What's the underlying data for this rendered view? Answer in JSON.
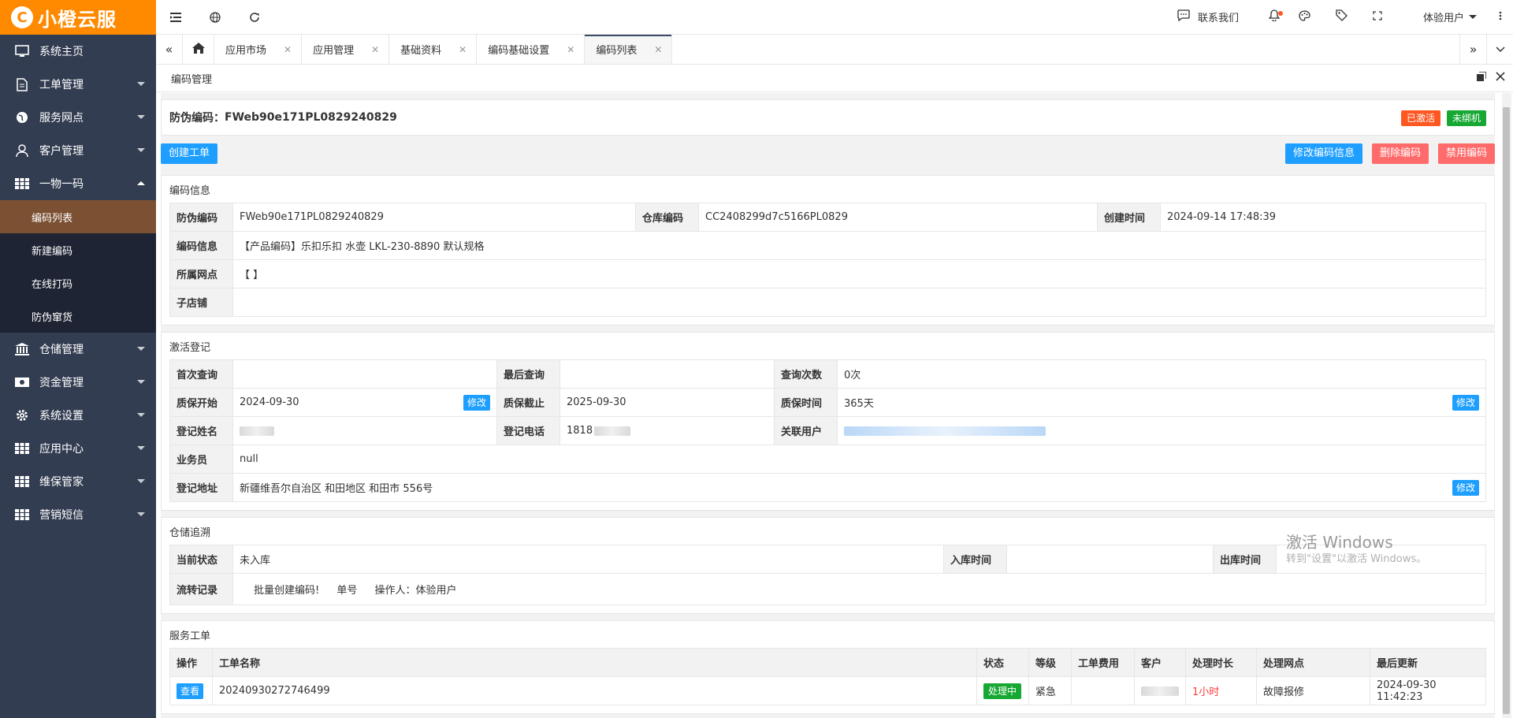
{
  "sidebar": {
    "logo_mark": "C",
    "logo_text": "小橙云服",
    "items": [
      {
        "label": "系统主页"
      },
      {
        "label": "工单管理"
      },
      {
        "label": "服务网点"
      },
      {
        "label": "客户管理"
      },
      {
        "label": "一物一码"
      },
      {
        "label": "仓储管理"
      },
      {
        "label": "资金管理"
      },
      {
        "label": "系统设置"
      },
      {
        "label": "应用中心"
      },
      {
        "label": "维保管家"
      },
      {
        "label": "营销短信"
      }
    ],
    "sub_items": [
      {
        "label": "编码列表"
      },
      {
        "label": "新建编码"
      },
      {
        "label": "在线打码"
      },
      {
        "label": "防伪窜货"
      }
    ]
  },
  "topbar": {
    "contact": "联系我们",
    "user": "体验用户"
  },
  "tabs": [
    {
      "label": "应用市场"
    },
    {
      "label": "应用管理"
    },
    {
      "label": "基础资料"
    },
    {
      "label": "编码基础设置"
    },
    {
      "label": "编码列表"
    }
  ],
  "panel": {
    "title": "编码管理",
    "code_label": "防伪编码：",
    "code_value": "FWeb90e171PL0829240829",
    "badge_activated": "已激活",
    "badge_not_bound": "未绑机",
    "btn_create_order": "创建工单",
    "btn_edit_info": "修改编码信息",
    "btn_delete": "删除编码",
    "btn_disable": "禁用编码"
  },
  "code_info": {
    "title": "编码信息",
    "fw_label": "防伪编码",
    "fw_value": "FWeb90e171PL0829240829",
    "warehouse_label": "仓库编码",
    "warehouse_value": "CC2408299d7c5166PL0829",
    "created_label": "创建时间",
    "created_value": "2024-09-14 17:48:39",
    "info_label": "编码信息",
    "info_value": "【产品编码】乐扣乐扣 水壶 LKL-230-8890 默认规格",
    "outlet_label": "所属网点",
    "outlet_value": "【 】",
    "substore_label": "子店铺",
    "substore_value": ""
  },
  "activation": {
    "title": "激活登记",
    "first_query_label": "首次查询",
    "first_query_value": "",
    "last_query_label": "最后查询",
    "last_query_value": "",
    "query_count_label": "查询次数",
    "query_count_value": "0次",
    "warranty_start_label": "质保开始",
    "warranty_start_value": "2024-09-30",
    "warranty_end_label": "质保截止",
    "warranty_end_value": "2025-09-30",
    "warranty_time_label": "质保时间",
    "warranty_time_value": "365天",
    "name_label": "登记姓名",
    "phone_label": "登记电话",
    "phone_value": "1818",
    "linked_user_label": "关联用户",
    "salesman_label": "业务员",
    "salesman_value": "null",
    "address_label": "登记地址",
    "address_value": "新疆维吾尔自治区 和田地区 和田市 556号",
    "edit": "修改"
  },
  "warehouse": {
    "title": "仓储追溯",
    "state_label": "当前状态",
    "state_value": "未入库",
    "in_label": "入库时间",
    "in_value": "",
    "out_label": "出库时间",
    "out_value": "",
    "flow_label": "流转记录",
    "flow_text": "批量创建编码!",
    "flow_no": "单号",
    "flow_operator": "操作人：体验用户"
  },
  "service": {
    "title": "服务工单",
    "headers": [
      "操作",
      "工单名称",
      "状态",
      "等级",
      "工单费用",
      "客户",
      "处理时长",
      "处理网点",
      "最后更新"
    ],
    "row": {
      "action": "查看",
      "name": "20240930272746499",
      "status": "处理中",
      "level": "紧急",
      "fee": "",
      "duration": "1小时",
      "outlet": "故障报修",
      "updated": "2024-09-30 11:42:23"
    }
  },
  "watermark": {
    "title": "激活 Windows",
    "sub": "转到\"设置\"以激活 Windows。"
  },
  "colors": {
    "sidebar_bg": "#333d52",
    "logo_bg": "#ff8a00",
    "active_sub": "#7c5133",
    "primary": "#1e9fff",
    "danger": "#ff6b6b",
    "success": "#16a832"
  }
}
